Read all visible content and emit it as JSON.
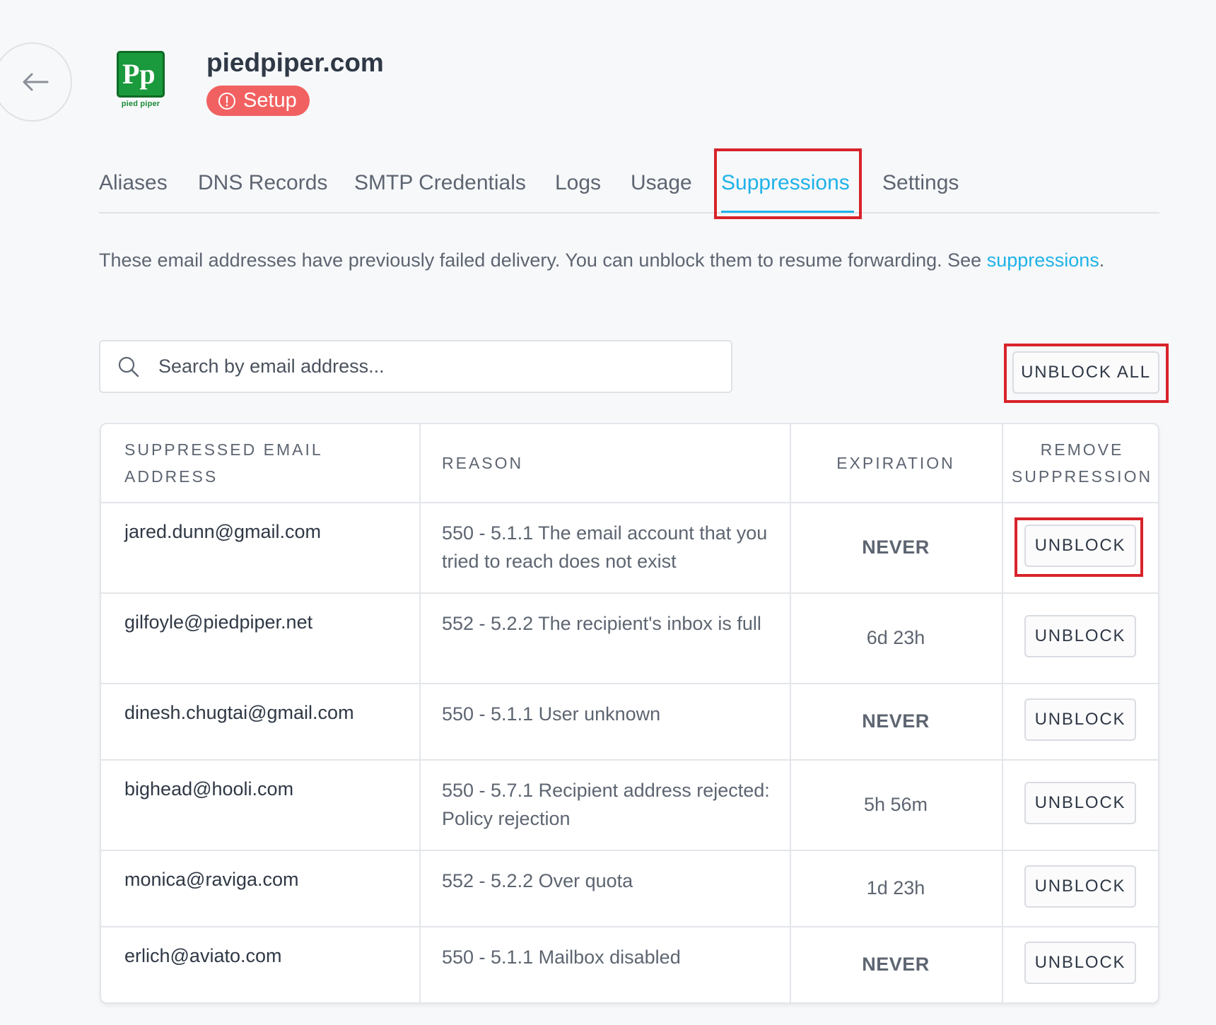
{
  "header": {
    "domain": "piedpiper.com",
    "status_badge": "Setup",
    "logo_caption": "pied piper",
    "logo_letters": "Pp"
  },
  "tabs": [
    {
      "label": "Aliases",
      "active": false
    },
    {
      "label": "DNS Records",
      "active": false
    },
    {
      "label": "SMTP Credentials",
      "active": false
    },
    {
      "label": "Logs",
      "active": false
    },
    {
      "label": "Usage",
      "active": false
    },
    {
      "label": "Suppressions",
      "active": true
    },
    {
      "label": "Settings",
      "active": false
    }
  ],
  "description": {
    "text": "These email addresses have previously failed delivery. You can unblock them to resume forwarding. See ",
    "link": "suppressions",
    "suffix": "."
  },
  "search": {
    "placeholder": "Search by email address...",
    "value": ""
  },
  "unblock_all_label": "UNBLOCK ALL",
  "table": {
    "headers": {
      "email": "SUPPRESSED EMAIL ADDRESS",
      "reason": "REASON",
      "expiration": "EXPIRATION",
      "remove": "REMOVE SUPPRESSION"
    },
    "rows": [
      {
        "email": "jared.dunn@gmail.com",
        "reason": "550 - 5.1.1 The email account that you tried to reach does not exist",
        "expiration": "NEVER",
        "action": "UNBLOCK"
      },
      {
        "email": "gilfoyle@piedpiper.net",
        "reason": "552 - 5.2.2 The recipient's inbox is full",
        "expiration": "6d 23h",
        "action": "UNBLOCK"
      },
      {
        "email": "dinesh.chugtai@gmail.com",
        "reason": "550 - 5.1.1 User unknown",
        "expiration": "NEVER",
        "action": "UNBLOCK"
      },
      {
        "email": "bighead@hooli.com",
        "reason": "550 - 5.7.1 Recipient address rejected: Policy rejection",
        "expiration": "5h 56m",
        "action": "UNBLOCK"
      },
      {
        "email": "monica@raviga.com",
        "reason": "552 - 5.2.2 Over quota",
        "expiration": "1d 23h",
        "action": "UNBLOCK"
      },
      {
        "email": "erlich@aviato.com",
        "reason": "550 - 5.1.1 Mailbox disabled",
        "expiration": "NEVER",
        "action": "UNBLOCK"
      }
    ]
  },
  "colors": {
    "accent": "#1fb2e8",
    "badge": "#f26161",
    "highlight": "#d8232a",
    "logo_green": "#1a9a3c"
  },
  "icons": {
    "back": "arrow-left-icon",
    "badge": "alert-circle-icon",
    "search": "search-icon"
  }
}
